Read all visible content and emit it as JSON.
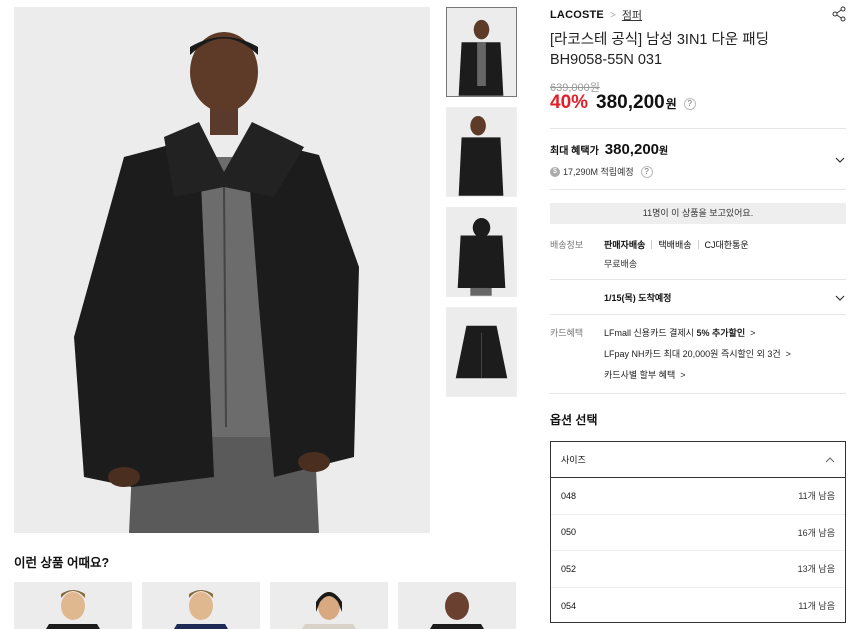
{
  "product": {
    "brand": "LACOSTE",
    "category": "점퍼",
    "title": "[라코스테 공식] 남성 3IN1 다운 패딩 BH9058-55N 031",
    "original_price": "639,000원",
    "discount": "40%",
    "price": "380,200",
    "currency": "원",
    "help_icon": "?"
  },
  "benefit": {
    "label": "최대 혜택가",
    "price": "380,200",
    "currency": "원",
    "points": "17,290M 적립예정",
    "coin_icon": "$"
  },
  "viewers": "11명이 이 상품을 보고있어요.",
  "shipping": {
    "label": "배송정보",
    "options": [
      "판매자배송",
      "택배배송",
      "CJ대한통운"
    ],
    "free": "무료배송",
    "arrival": "1/15(목) 도착예정"
  },
  "card": {
    "label": "카드혜택",
    "line1_prefix": "LFmall 신용카드 결제시 ",
    "line1_bold": "5% 추가할인",
    "line2": "LFpay NH카드 최대 20,000원 즉시할인 외 3건",
    "line3": "카드사별 할부 혜택",
    "arrow": ">"
  },
  "options": {
    "title": "옵션 선택",
    "select_label": "사이즈",
    "sizes": [
      {
        "size": "048",
        "stock": "11개 남음"
      },
      {
        "size": "050",
        "stock": "16개 남음"
      },
      {
        "size": "052",
        "stock": "13개 남음"
      },
      {
        "size": "054",
        "stock": "11개 남음"
      }
    ]
  },
  "recommend": {
    "title": "이런 상품 어때요?"
  },
  "colors": {
    "discount": "#e0202a",
    "bg_gray": "#eeeeee",
    "jacket": "#1b1b1b"
  }
}
